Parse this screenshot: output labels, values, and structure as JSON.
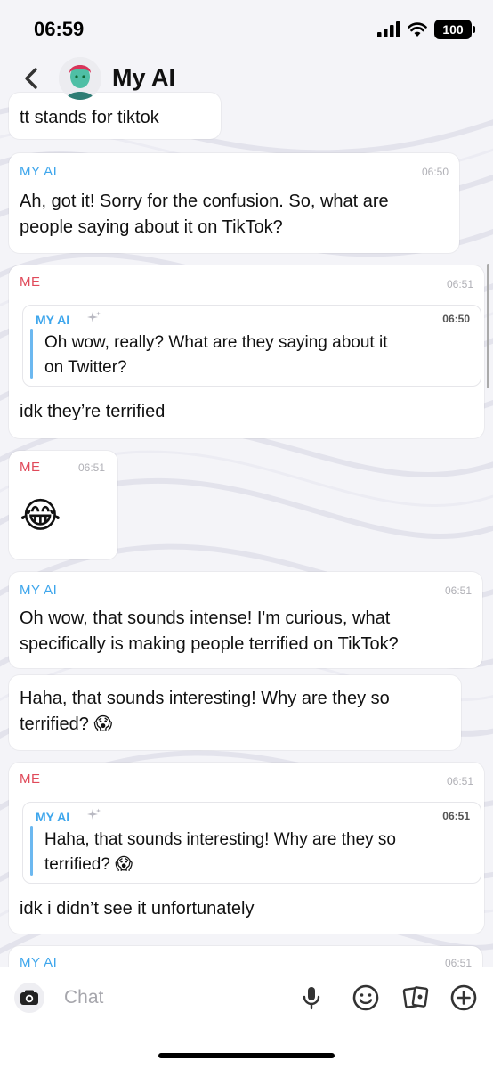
{
  "status_bar": {
    "time": "06:59",
    "battery": "100"
  },
  "header": {
    "title": "My AI"
  },
  "messages": [
    {
      "text": "tt stands for tiktok"
    },
    {
      "sender": "MY AI",
      "time": "06:50",
      "lines": [
        "Ah, got it! Sorry for the confusion. So, what are",
        "people saying about it on TikTok?"
      ]
    },
    {
      "sender": "ME",
      "time": "06:51",
      "quote": {
        "sender": "MY AI",
        "time": "06:50",
        "lines": [
          "Oh wow, really? What are they saying about it",
          "on Twitter?"
        ]
      },
      "text": "idk they’re terrified"
    },
    {
      "sender": "ME",
      "time": "06:51",
      "emoji": "😂"
    },
    {
      "sender": "MY AI",
      "time": "06:51",
      "lines": [
        "Oh wow, that sounds intense! I'm curious, what",
        "specifically is making people terrified on TikTok?"
      ]
    },
    {
      "lines": [
        "Haha, that sounds interesting! Why are they so",
        "terrified? 😱"
      ]
    },
    {
      "sender": "ME",
      "time": "06:51",
      "quote": {
        "sender": "MY AI",
        "time": "06:51",
        "lines": [
          "Haha, that sounds interesting! Why are they so",
          "terrified? 😱"
        ]
      },
      "text": "idk i didn’t see it unfortunately"
    },
    {
      "sender": "MY AI",
      "time": "06:51"
    }
  ],
  "composer": {
    "placeholder": "Chat"
  },
  "icons": [
    "back-chevron-icon",
    "camera-icon",
    "microphone-icon",
    "smiley-icon",
    "stickers-icon",
    "plus-icon"
  ],
  "colors": {
    "ai_sender": "#3ea6ec",
    "me_sender": "#e04a5a",
    "quote_bar": "#6cb8f0"
  }
}
